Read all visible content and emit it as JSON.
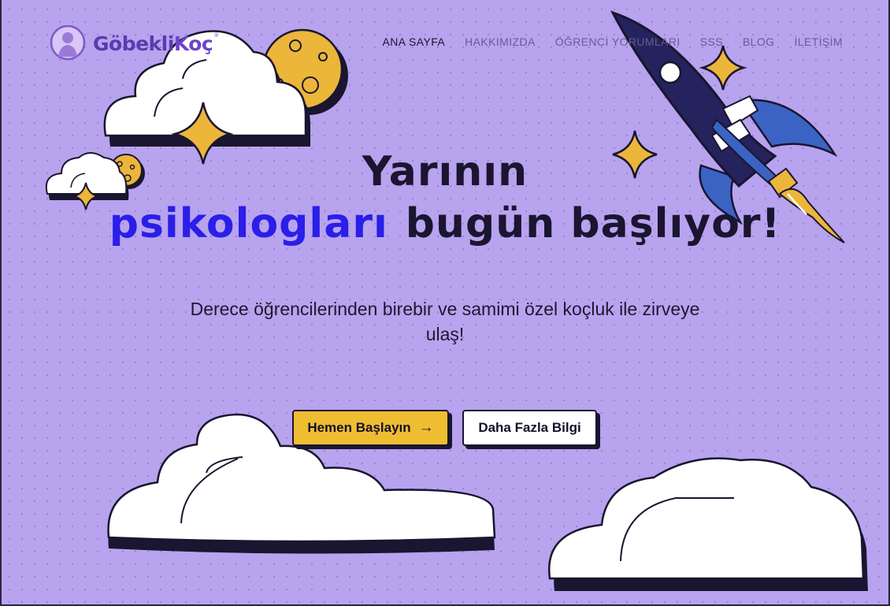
{
  "brand": {
    "name_part1": "Göbekli",
    "name_part2": "Koç",
    "reg": "®"
  },
  "nav": {
    "items": [
      {
        "label": "ANA SAYFA",
        "active": true
      },
      {
        "label": "HAKKIMIZDA",
        "active": false
      },
      {
        "label": "ÖĞRENCİ YORUMLARI",
        "active": false
      },
      {
        "label": "SSS",
        "active": false
      },
      {
        "label": "BLOG",
        "active": false
      },
      {
        "label": "İLETİŞİM",
        "active": false
      }
    ]
  },
  "hero": {
    "line1": "Yarının",
    "highlight": "psikologları",
    "line2_rest": "bugün başlıyor!",
    "subtitle": "Derece öğrencilerinden birebir ve samimi özel koçluk ile zirveye ulaş!"
  },
  "buttons": {
    "primary_label": "Hemen Başlayın",
    "primary_arrow": "→",
    "secondary_label": "Daha Fazla Bilgi"
  },
  "colors": {
    "background": "#b8a3ee",
    "accent_blue": "#2a1ee8",
    "button_yellow": "#efbd32",
    "brand_purple": "#5a3ab0",
    "rocket_navy": "#24235e",
    "rocket_blue": "#3b63c4",
    "star_gold": "#ebb63a"
  }
}
